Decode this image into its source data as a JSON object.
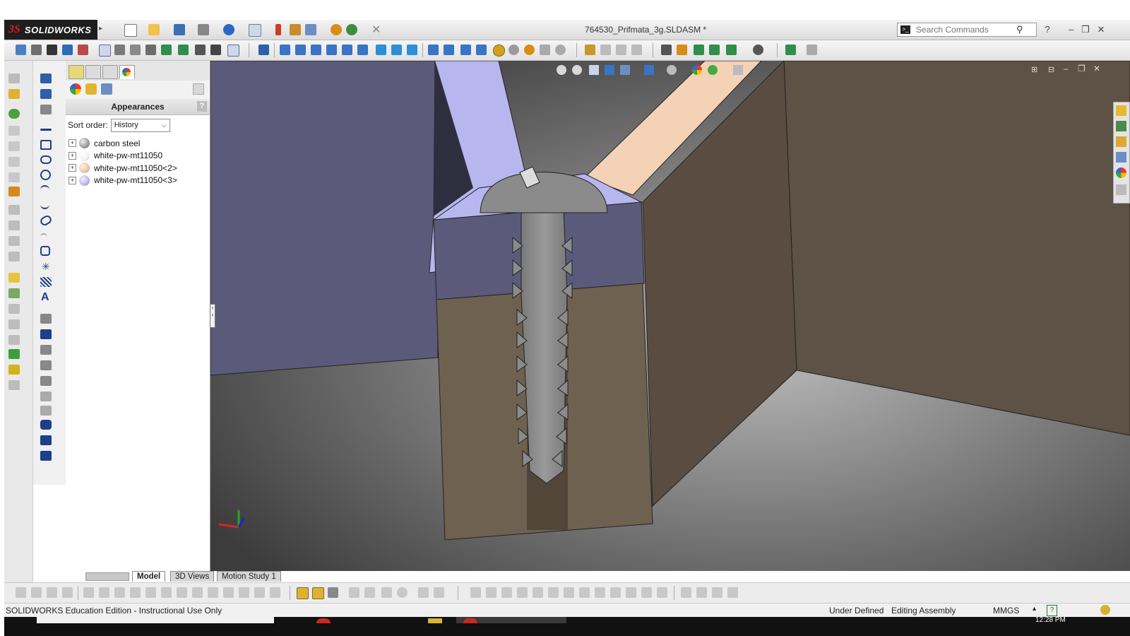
{
  "app": {
    "brand": "SOLIDWORKS",
    "logo_mark": "3S",
    "document_title": "764530_Prifmata_3g.SLDASM *"
  },
  "search": {
    "placeholder": "Search Commands",
    "value": ""
  },
  "window_controls": {
    "help": "?",
    "minimize": "–",
    "restore": "❐",
    "close": "✕"
  },
  "feature_manager": {
    "header": "Appearances",
    "help": "?",
    "sort_label": "Sort order:",
    "sort_value": "History",
    "items": [
      {
        "label": "carbon steel",
        "color": "#9a9a9a"
      },
      {
        "label": "white-pw-mt11050",
        "color": "#f4f4f4"
      },
      {
        "label": "white-pw-mt11050<2>",
        "color": "#e9c6a7"
      },
      {
        "label": "white-pw-mt11050<3>",
        "color": "#b9b9ea"
      }
    ]
  },
  "bottom_tabs": {
    "model": "Model",
    "views3d": "3D Views",
    "motion": "Motion Study 1"
  },
  "status": {
    "edition": "SOLIDWORKS Education Edition - Instructional Use Only",
    "state": "Under Defined",
    "mode": "Editing Assembly",
    "units": "MMGS",
    "help": "?"
  },
  "taskbar": {
    "clock": "12:28 PM"
  },
  "colors": {
    "accent_red": "#e31d1a",
    "part_lavender": "#b7b6ee",
    "part_peach": "#f3d2b6",
    "part_brown": "#6f6150",
    "part_slate": "#5c5a7a",
    "screw_gray": "#8b8b8b"
  }
}
